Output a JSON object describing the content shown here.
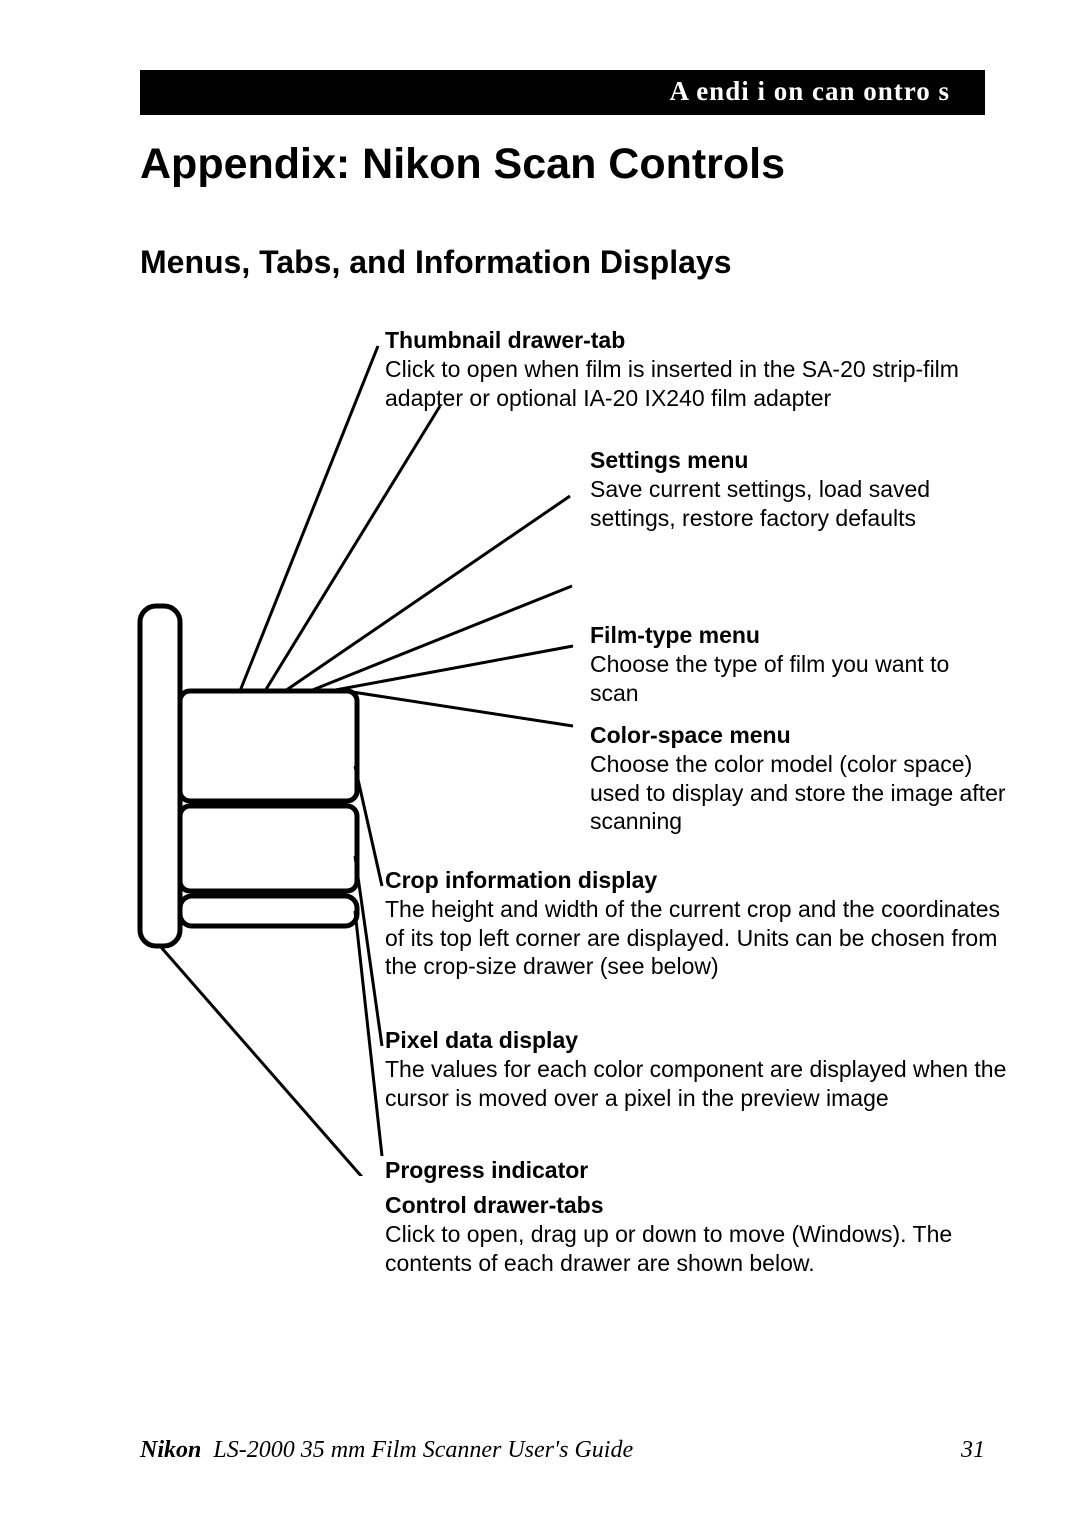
{
  "header_bar": "A    endi      i  on    can    ontro s",
  "main_title": "Appendix:  Nikon Scan Controls",
  "section_title": "Menus, Tabs, and Information Displays",
  "callouts": {
    "thumbnail": {
      "title": "Thumbnail drawer-tab",
      "body": "Click to open when film is inserted in the SA-20 strip-film adapter or optional IA-20 IX240 film adapter"
    },
    "settings": {
      "title": "Settings menu",
      "body": "Save current settings, load saved settings, restore factory defaults"
    },
    "filmtype": {
      "title": "Film-type menu",
      "body": "Choose the type of film you want to scan"
    },
    "colorspace": {
      "title": "Color-space menu",
      "body": "Choose the color model (color space) used to display and store the image after scanning"
    },
    "cropinfo": {
      "title": "Crop information display",
      "body": "The height and width of the current crop and the coordinates of its top left corner are displayed. Units can be chosen from the crop-size drawer (see below)"
    },
    "pixeldata": {
      "title": "Pixel data display",
      "body": "The values for each color component are displayed when the cursor is moved over a pixel in the preview image"
    },
    "progress": {
      "title": "Progress indicator"
    },
    "controltabs": {
      "title": "Control drawer-tabs",
      "body": "Click to open, drag up or down to move (Windows). The contents of each drawer are shown below."
    }
  },
  "footer": {
    "brand": "Nikon",
    "guide": " LS-2000 35 mm Film Scanner User's Guide",
    "page": "31"
  }
}
